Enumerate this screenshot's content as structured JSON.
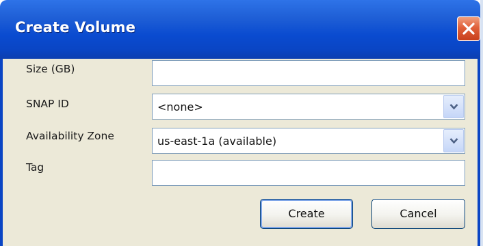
{
  "dialog": {
    "title": "Create Volume",
    "close_icon": "close-icon"
  },
  "form": {
    "size_label": "Size (GB)",
    "size_value": "",
    "snap_label": "SNAP ID",
    "snap_value": "<none>",
    "zone_label": "Availability Zone",
    "zone_value": "us-east-1a (available)",
    "tag_label": "Tag",
    "tag_value": ""
  },
  "buttons": {
    "create_label": "Create",
    "cancel_label": "Cancel"
  },
  "colors": {
    "titlebar": "#0a45c4",
    "dialog_body": "#ece9d8",
    "close_button": "#e0603a"
  }
}
